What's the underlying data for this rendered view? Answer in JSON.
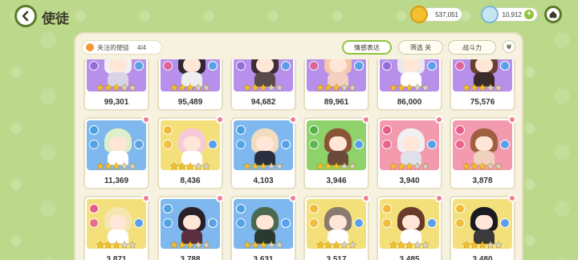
{
  "header": {
    "title": "使徒",
    "gold": "537,051",
    "gems": "10,912"
  },
  "panel": {
    "followed_label": "关注的使徒",
    "followed_count": "4/4",
    "btn_emotion": "情感表达",
    "btn_filter": "筛选 关",
    "btn_power": "战斗力"
  },
  "colors": {
    "bg": "#bcd98b",
    "accent_green": "#8fc43d",
    "purple": "#a97ee0",
    "blue": "#6aaeea",
    "yellow": "#f2d96a",
    "green": "#7cc85a",
    "pink": "#f08aa0"
  },
  "cards": [
    {
      "power": "99,301",
      "bg": "#b690ea",
      "elem": "#8d6ad8",
      "stars": 3,
      "hair": "#f2f0f4",
      "body": "#d9d3e8"
    },
    {
      "power": "95,489",
      "bg": "#b690ea",
      "elem": "#e55c8a",
      "stars": 3,
      "hair": "#2b2630",
      "body": "#eeeeee"
    },
    {
      "power": "94,682",
      "bg": "#b690ea",
      "elem": "#8d6ad8",
      "stars": 3,
      "hair": "#3b2f35",
      "body": "#5a4a4a"
    },
    {
      "power": "89,961",
      "bg": "#b690ea",
      "elem": "#e55c8a",
      "stars": 3,
      "hair": "#f5c6a8",
      "body": "#f2d0c0"
    },
    {
      "power": "86,000",
      "bg": "#b690ea",
      "elem": "#8d6ad8",
      "stars": 3,
      "hair": "#e8e8ee",
      "body": "#ffffff"
    },
    {
      "power": "75,576",
      "bg": "#b690ea",
      "elem": "#e55c8a",
      "stars": 3,
      "hair": "#6a4030",
      "body": "#3a2a2a"
    },
    {
      "power": "11,369",
      "bg": "#7fb8ee",
      "elem": "#4ca0e0",
      "stars": 3,
      "hair": "#dfeecb",
      "body": "#ffffff"
    },
    {
      "power": "8,436",
      "bg": "#f3e07a",
      "elem": "#f1b93a",
      "stars": 3,
      "hair": "#f6c8d8",
      "body": "#ffffff"
    },
    {
      "power": "4,103",
      "bg": "#7fb8ee",
      "elem": "#4ca0e0",
      "stars": 3,
      "hair": "#f2dcc0",
      "body": "#2a3040"
    },
    {
      "power": "3,946",
      "bg": "#8fd16a",
      "elem": "#56b04a",
      "stars": 3,
      "hair": "#8a5436",
      "body": "#6a4a3a"
    },
    {
      "power": "3,940",
      "bg": "#f39aae",
      "elem": "#e55c8a",
      "stars": 3,
      "hair": "#f0f0f2",
      "body": "#e0e0e8"
    },
    {
      "power": "3,878",
      "bg": "#f39aae",
      "elem": "#e55c8a",
      "stars": 3,
      "hair": "#a06040",
      "body": "#f2d0c0"
    },
    {
      "power": "3,871",
      "bg": "#f3e07a",
      "elem": "#e55c8a",
      "stars": 3,
      "hair": "#f4e6b0",
      "body": "#ffffff"
    },
    {
      "power": "3,788",
      "bg": "#7fb8ee",
      "elem": "#4ca0e0",
      "stars": 3,
      "hair": "#2a2028",
      "body": "#5a3040"
    },
    {
      "power": "3,631",
      "bg": "#7fb8ee",
      "elem": "#4ca0e0",
      "stars": 3,
      "hair": "#4a6a50",
      "body": "#2a3a30"
    },
    {
      "power": "3,517",
      "bg": "#f3e07a",
      "elem": "#f1b93a",
      "stars": 3,
      "hair": "#8a7a70",
      "body": "#ffffff"
    },
    {
      "power": "3,485",
      "bg": "#f3e07a",
      "elem": "#f1b93a",
      "stars": 3,
      "hair": "#6a3a2a",
      "body": "#ffffff"
    },
    {
      "power": "3,480",
      "bg": "#f3e07a",
      "elem": "#f1b93a",
      "stars": 3,
      "hair": "#1a1a20",
      "body": "#3a3a3a"
    }
  ]
}
